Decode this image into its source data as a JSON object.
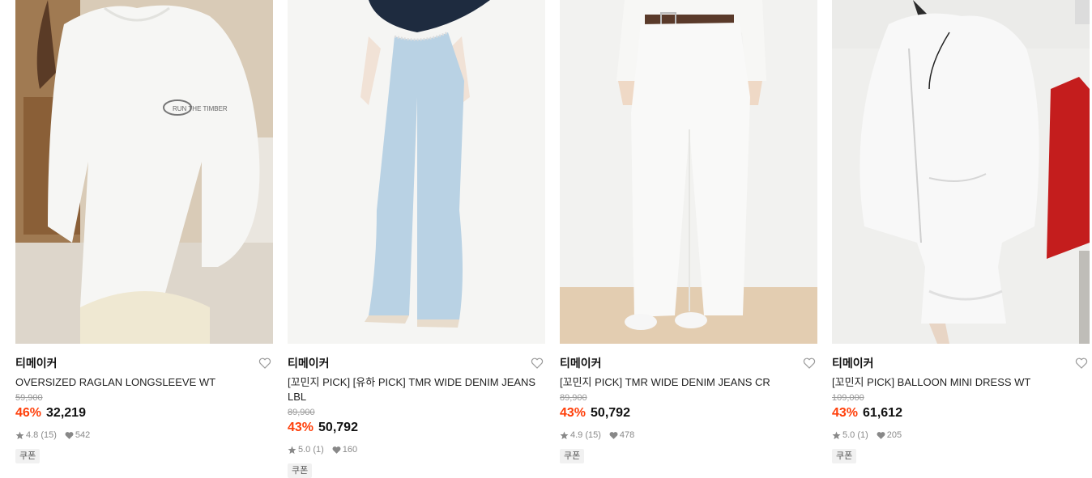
{
  "products": [
    {
      "brand": "티메이커",
      "name": "OVERSIZED RAGLAN LONGSLEEVE WT",
      "original_price": "59,900",
      "discount": "46%",
      "price": "32,219",
      "rating": "4.8 (15)",
      "likes": "542",
      "badge": "쿠폰",
      "image_print": "RUN THE TIMBER"
    },
    {
      "brand": "티메이커",
      "name": "[꼬민지 PICK] [유하 PICK] TMR WIDE DENIM JEANS LBL",
      "original_price": "89,900",
      "discount": "43%",
      "price": "50,792",
      "rating": "5.0 (1)",
      "likes": "160",
      "badge": "쿠폰"
    },
    {
      "brand": "티메이커",
      "name": "[꼬민지 PICK] TMR WIDE DENIM JEANS CR",
      "original_price": "89,900",
      "discount": "43%",
      "price": "50,792",
      "rating": "4.9 (15)",
      "likes": "478",
      "badge": "쿠폰"
    },
    {
      "brand": "티메이커",
      "name": "[꼬민지 PICK] BALLOON MINI DRESS WT",
      "original_price": "109,000",
      "discount": "43%",
      "price": "61,612",
      "rating": "5.0 (1)",
      "likes": "205",
      "badge": "쿠폰"
    }
  ],
  "icons": {
    "like": "heart-outline-icon",
    "rating": "star-icon",
    "likes_count": "heart-filled-icon"
  },
  "colors": {
    "discount": "#ff3f0a",
    "muted": "#8a8a8a",
    "badge_bg": "#f1f1f1"
  }
}
